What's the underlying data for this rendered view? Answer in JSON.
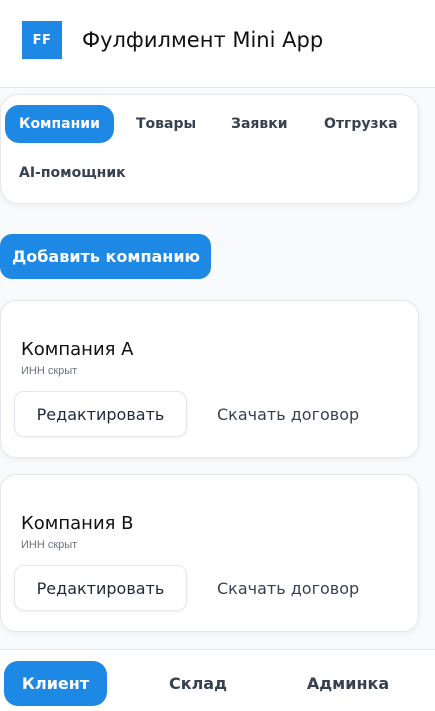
{
  "header": {
    "logo_text": "FF",
    "title": "Фулфилмент Mini App"
  },
  "tabs": [
    {
      "label": "Компании",
      "active": true
    },
    {
      "label": "Товары",
      "active": false
    },
    {
      "label": "Заявки",
      "active": false
    },
    {
      "label": "Отгрузка",
      "active": false
    },
    {
      "label": "AI-помощник",
      "active": false
    }
  ],
  "actions": {
    "add_company_label": "Добавить компанию"
  },
  "companies": [
    {
      "name": "Компания A",
      "inn": "ИНН скрыт",
      "edit_label": "Редактировать",
      "download_label": "Скачать договор"
    },
    {
      "name": "Компания B",
      "inn": "ИНН скрыт",
      "edit_label": "Редактировать",
      "download_label": "Скачать договор"
    }
  ],
  "bottom_nav": [
    {
      "label": "Клиент",
      "active": true
    },
    {
      "label": "Склад",
      "active": false
    },
    {
      "label": "Админка",
      "active": false
    }
  ],
  "colors": {
    "accent": "#1e88e5",
    "background": "#f8fafc",
    "card": "#ffffff",
    "border": "#e5e7eb"
  }
}
